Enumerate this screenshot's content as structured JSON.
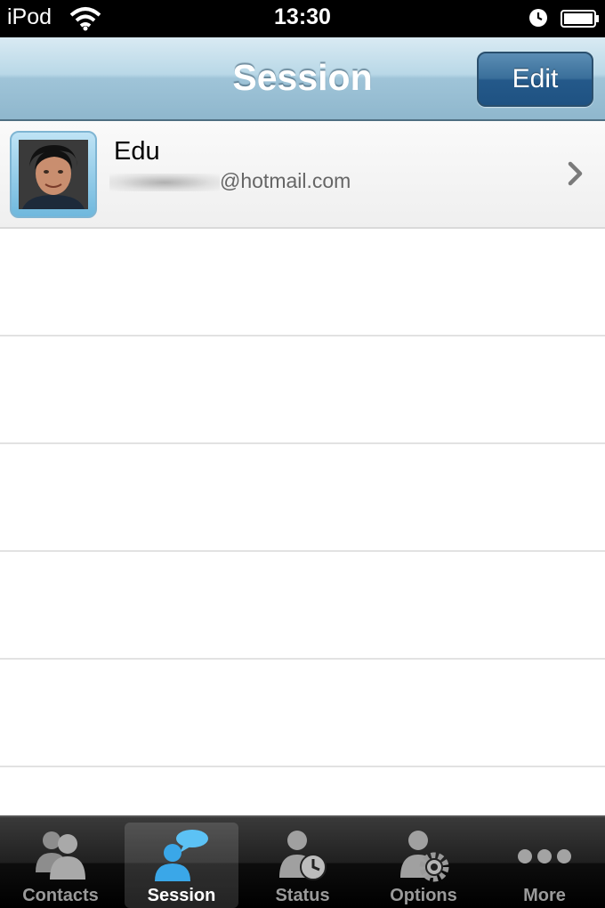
{
  "status_bar": {
    "carrier": "iPod",
    "time": "13:30",
    "icons": [
      "wifi-icon",
      "clock-icon",
      "battery-icon"
    ]
  },
  "nav": {
    "title": "Session",
    "edit_label": "Edit"
  },
  "sessions": [
    {
      "name": "Edu",
      "email_visible": "@hotmail.com",
      "avatar": "user-photo"
    }
  ],
  "tabs": [
    {
      "label": "Contacts",
      "icon": "contacts-icon",
      "selected": false
    },
    {
      "label": "Session",
      "icon": "session-chat-icon",
      "selected": true
    },
    {
      "label": "Status",
      "icon": "status-clock-icon",
      "selected": false
    },
    {
      "label": "Options",
      "icon": "options-gear-icon",
      "selected": false
    },
    {
      "label": "More",
      "icon": "more-dots-icon",
      "selected": false
    }
  ],
  "colors": {
    "nav_gradient_top": "#d9eaf3",
    "nav_gradient_bottom": "#8fb7cd",
    "edit_button": "#24598a",
    "tab_selected_icon": "#3aa7e8"
  }
}
